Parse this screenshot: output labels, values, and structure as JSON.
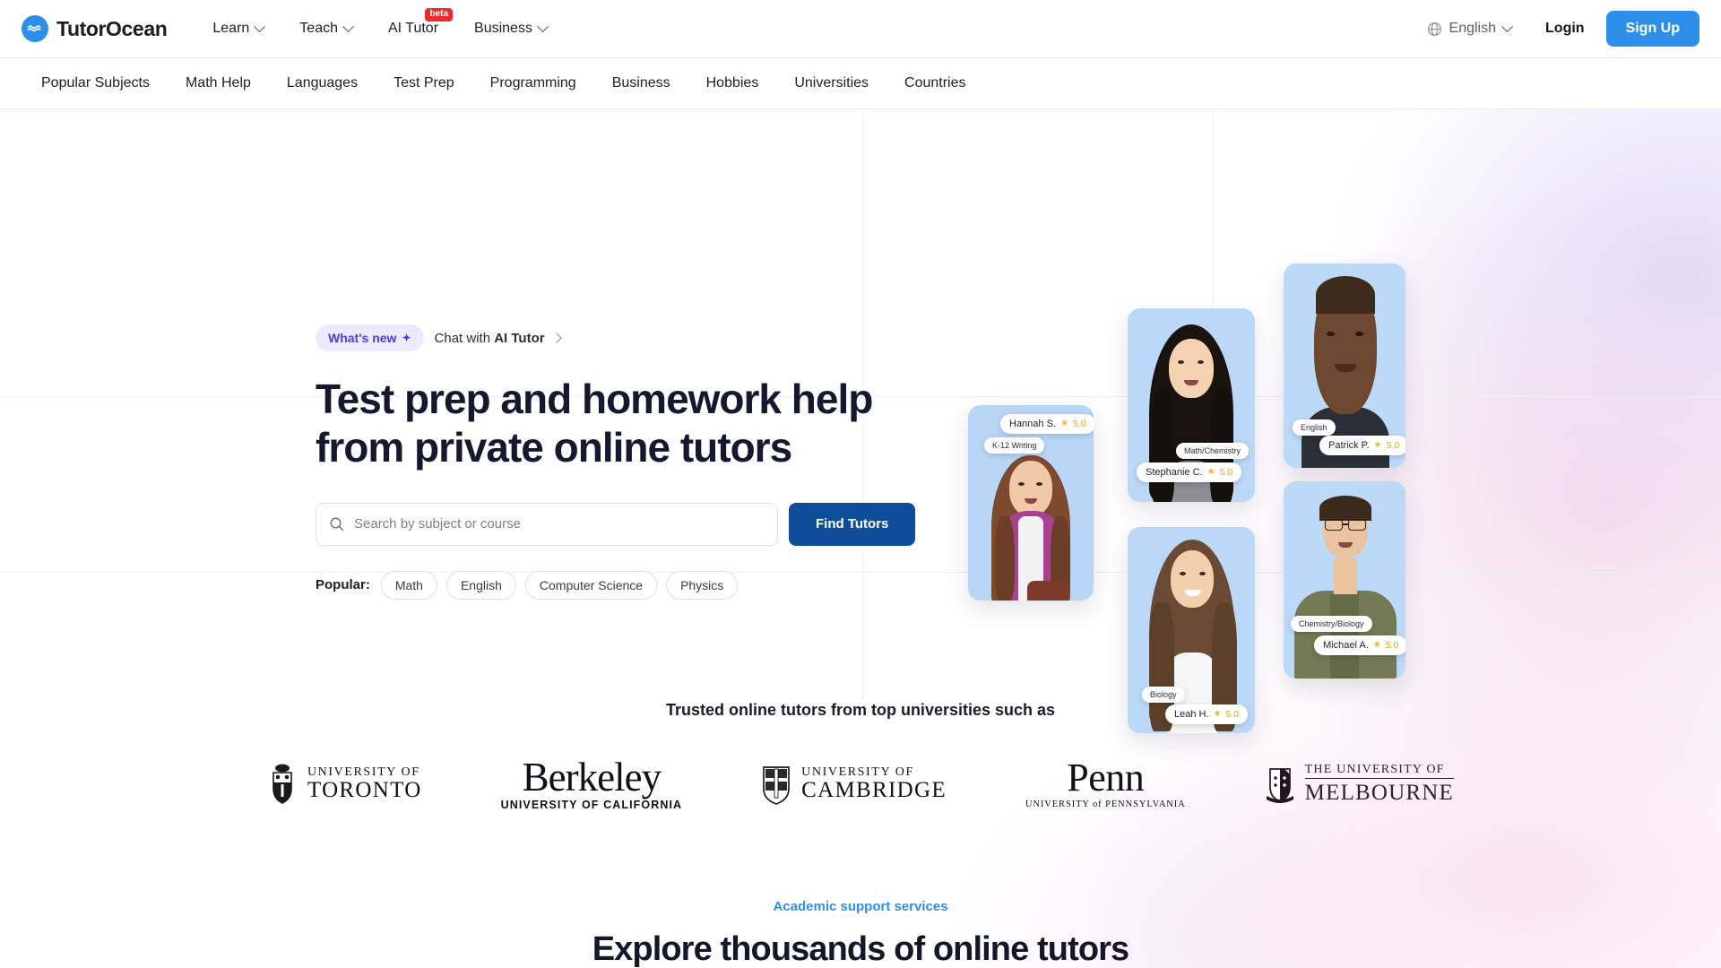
{
  "brand": {
    "name": "TutorOcean",
    "logo_icon": "ocean-wave-icon",
    "accent": "#2e8fea"
  },
  "header": {
    "nav": [
      {
        "label": "Learn",
        "has_dropdown": true,
        "badge": null
      },
      {
        "label": "Teach",
        "has_dropdown": true,
        "badge": null
      },
      {
        "label": "AI Tutor",
        "has_dropdown": false,
        "badge": "beta"
      },
      {
        "label": "Business",
        "has_dropdown": true,
        "badge": null
      }
    ],
    "language": "English",
    "language_icon": "globe-icon",
    "login_label": "Login",
    "signup_label": "Sign Up",
    "signup_color": "#2e8fea"
  },
  "subnav": {
    "items": [
      {
        "label": "Popular Subjects"
      },
      {
        "label": "Math Help"
      },
      {
        "label": "Languages"
      },
      {
        "label": "Test Prep"
      },
      {
        "label": "Programming"
      },
      {
        "label": "Business"
      },
      {
        "label": "Hobbies"
      },
      {
        "label": "Universities"
      },
      {
        "label": "Countries"
      }
    ]
  },
  "hero": {
    "badge_label": "What's new",
    "badge_icon": "sparkle-icon",
    "badge_color": "#4e3ce0",
    "link_prefix": "Chat with ",
    "link_bold": "AI Tutor",
    "title": "Test prep and homework help from private online tutors",
    "search_placeholder": "Search by subject or course",
    "search_value": "",
    "search_icon": "search-icon",
    "find_button": "Find Tutors",
    "find_button_color": "#0f4c9a",
    "popular_label": "Popular:",
    "popular_tags": [
      {
        "label": "Math"
      },
      {
        "label": "English"
      },
      {
        "label": "Computer Science"
      },
      {
        "label": "Physics"
      }
    ]
  },
  "tutor_cards": [
    {
      "name": "Hannah S.",
      "subject": "K-12 Writing",
      "rating": "5.0",
      "star_icon": "star-icon"
    },
    {
      "name": "Stephanie C.",
      "subject": "Math/Chemistry",
      "rating": "5.0",
      "star_icon": "star-icon"
    },
    {
      "name": "Patrick P.",
      "subject": "English",
      "rating": "5.0",
      "star_icon": "star-icon"
    },
    {
      "name": "Leah H.",
      "subject": "Biology",
      "rating": "5.0",
      "star_icon": "star-icon"
    },
    {
      "name": "Michael A.",
      "subject": "Chemistry/Biology",
      "rating": "5.0",
      "star_icon": "star-icon"
    }
  ],
  "universities": {
    "title": "Trusted online tutors from top universities such as",
    "logos": [
      {
        "line1": "UNIVERSITY OF",
        "line2": "TORONTO",
        "crest_icon": "toronto-crest-icon"
      },
      {
        "line1": "Berkeley",
        "line2": "UNIVERSITY OF CALIFORNIA",
        "crest_icon": null
      },
      {
        "line1": "UNIVERSITY OF",
        "line2": "CAMBRIDGE",
        "crest_icon": "cambridge-crest-icon"
      },
      {
        "line1": "Penn",
        "line2": "UNIVERSITY of PENNSYLVANIA",
        "crest_icon": null
      },
      {
        "line1": "THE UNIVERSITY OF",
        "line2": "MELBOURNE",
        "crest_icon": "melbourne-crest-icon"
      }
    ]
  },
  "bottom": {
    "eyebrow": "Academic support services",
    "eyebrow_color": "#2e8fea",
    "title": "Explore thousands of online tutors"
  }
}
